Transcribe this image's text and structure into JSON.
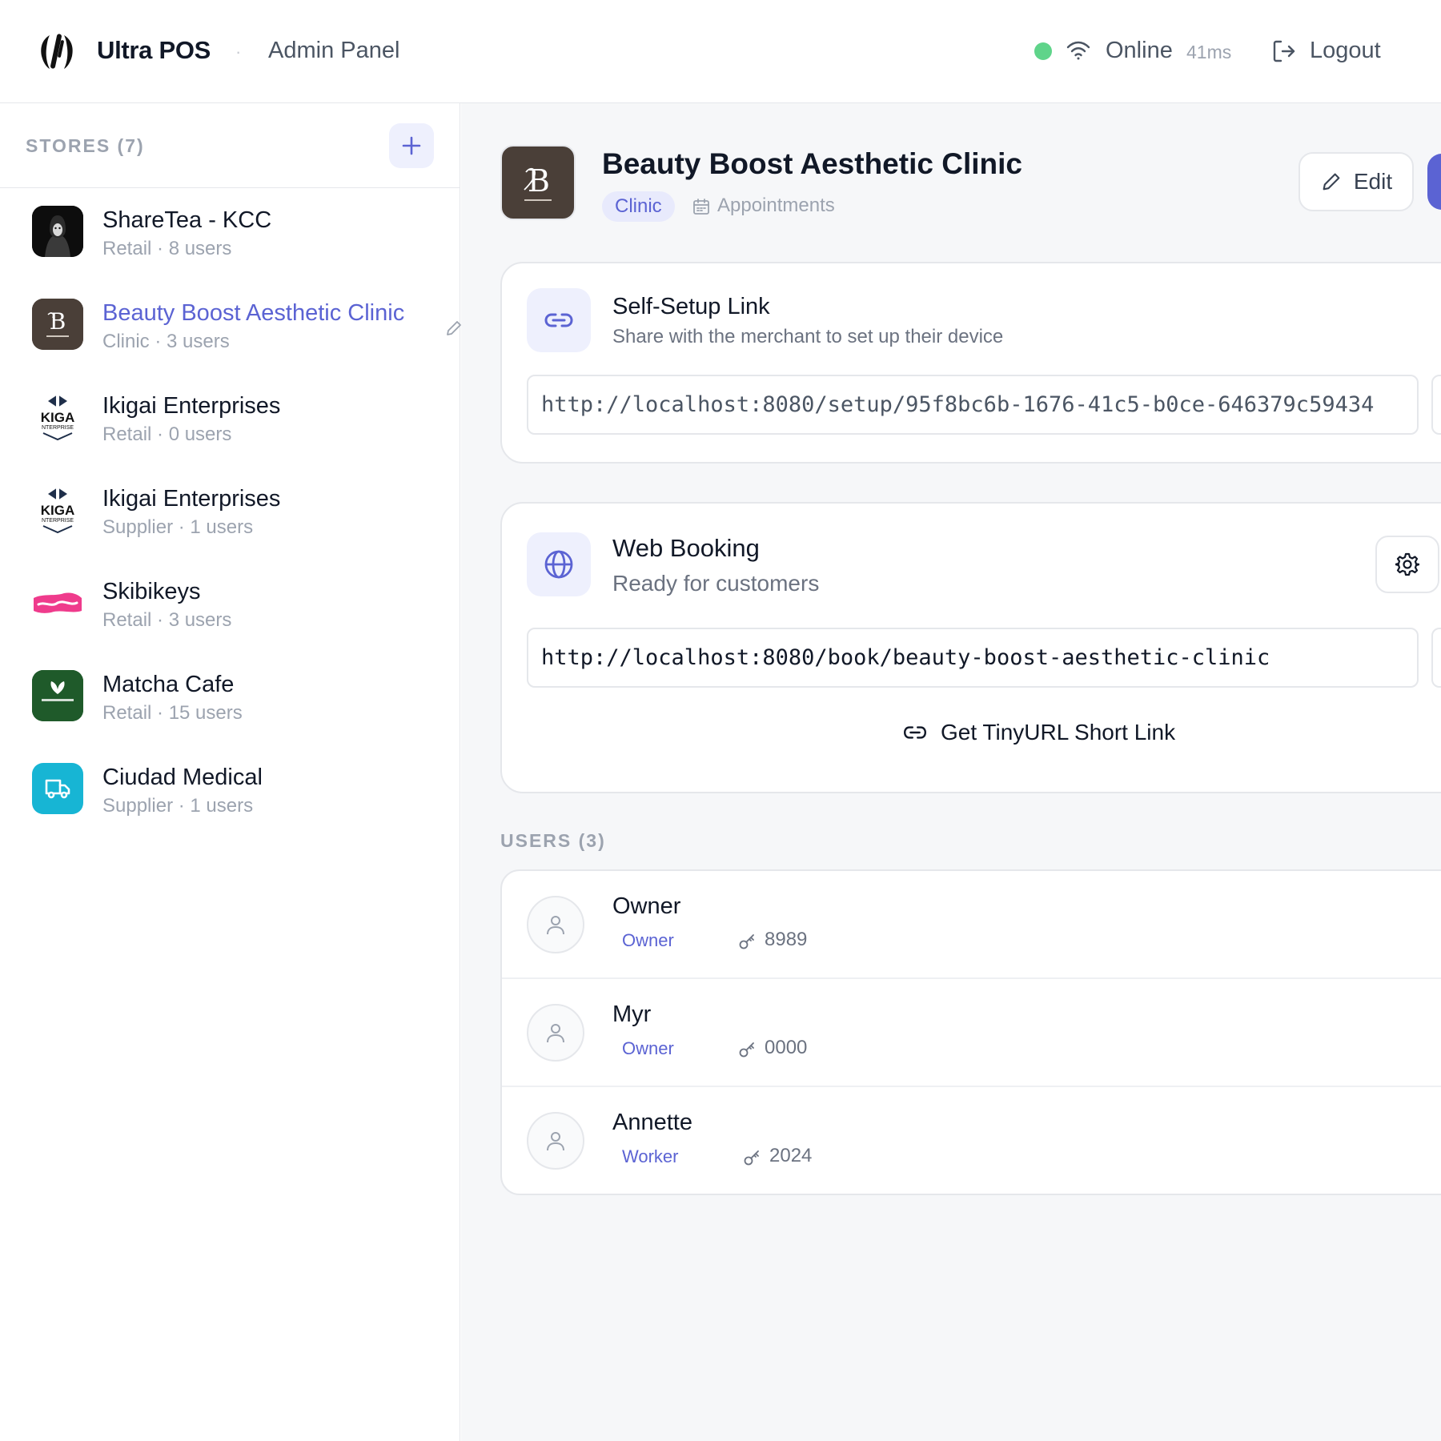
{
  "header": {
    "brand": "Ultra POS",
    "separator": "·",
    "subtitle": "Admin Panel",
    "status": "Online",
    "latency": "41ms",
    "logout": "Logout"
  },
  "sidebar": {
    "title": "STORES (7)",
    "stores": [
      {
        "name": "ShareTea - KCC",
        "meta": "Retail · 8 users"
      },
      {
        "name": "Beauty Boost Aesthetic Clinic",
        "meta": "Clinic · 3 users",
        "active": true
      },
      {
        "name": "Ikigai Enterprises",
        "meta": "Retail · 0 users"
      },
      {
        "name": "Ikigai Enterprises",
        "meta": "Supplier · 1 users"
      },
      {
        "name": "Skibikeys",
        "meta": "Retail · 3 users"
      },
      {
        "name": "Matcha Cafe",
        "meta": "Retail · 15 users"
      },
      {
        "name": "Ciudad Medical",
        "meta": "Supplier · 1 users"
      }
    ]
  },
  "detail": {
    "title": "Beauty Boost Aesthetic Clinic",
    "type": "Clinic",
    "mode": "Appointments",
    "edit": "Edit",
    "setup": {
      "title": "Self-Setup Link",
      "subtitle": "Share with the merchant to set up their device",
      "url": "http://localhost:8080/setup/95f8bc6b-1676-41c5-b0ce-646379c59434"
    },
    "booking": {
      "title": "Web Booking",
      "subtitle": "Ready for customers",
      "url": "http://localhost:8080/book/beauty-boost-aesthetic-clinic",
      "tinyurl": "Get TinyURL Short Link"
    },
    "users_title": "USERS (3)",
    "users": [
      {
        "name": "Owner",
        "role": "Owner",
        "pin": "8989"
      },
      {
        "name": "Myr",
        "role": "Owner",
        "pin": "0000"
      },
      {
        "name": "Annette",
        "role": "Worker",
        "pin": "2024"
      }
    ]
  },
  "colors": {
    "accent": "#5b63d3",
    "online": "#5fd48a",
    "accent_bg": "#eef0fd"
  },
  "icons": [
    "brand-logo-icon",
    "wifi-icon",
    "logout-icon",
    "plus-icon",
    "pencil-icon",
    "calendar-icon",
    "link-icon",
    "globe-icon",
    "gear-icon",
    "user-icon",
    "key-icon"
  ]
}
